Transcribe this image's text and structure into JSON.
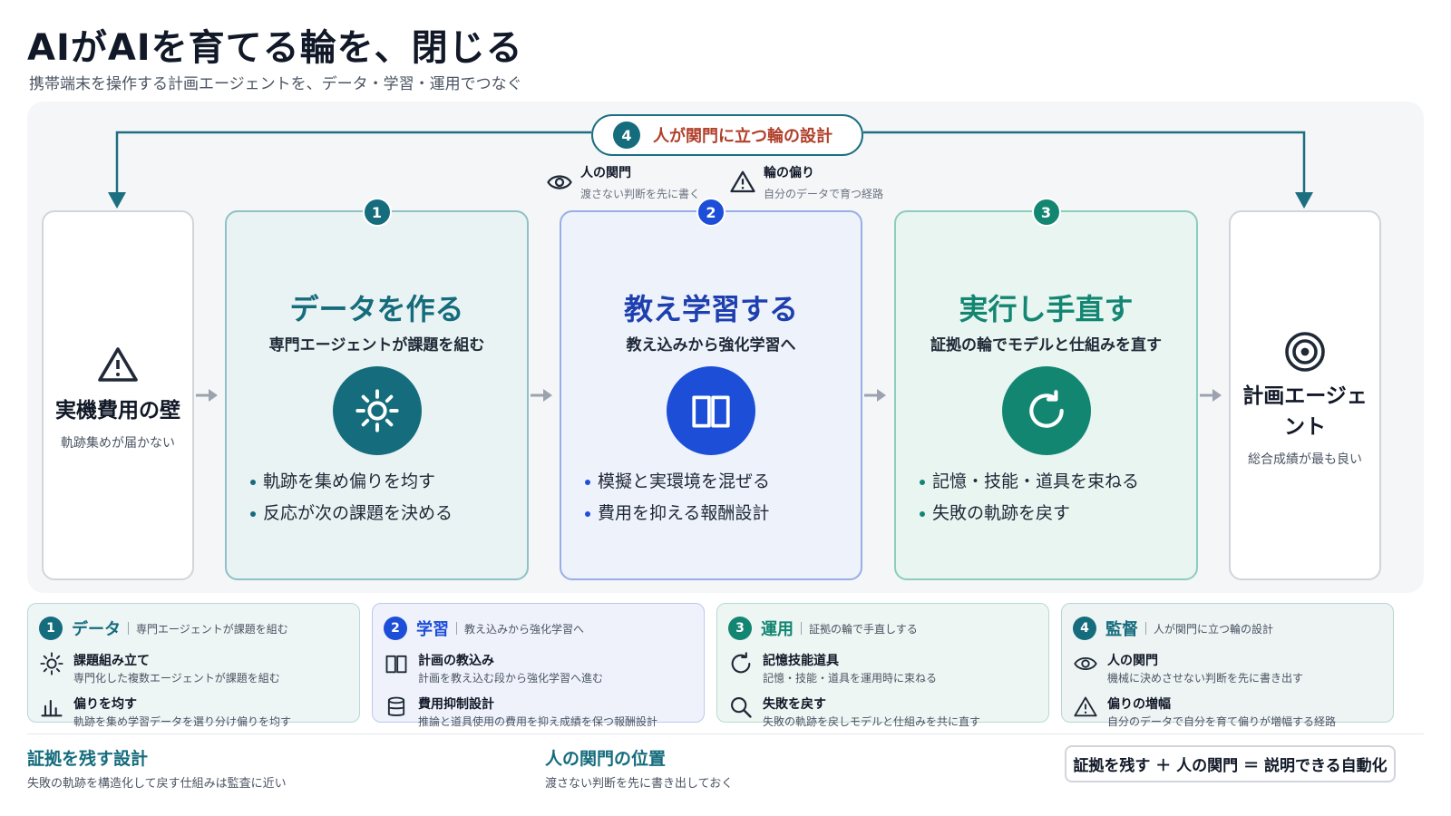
{
  "header": {
    "title": "AIがAIを育てる輪を、閉じる",
    "subtitle": "携帯端末を操作する計画エージェントを、データ・学習・運用でつなぐ"
  },
  "loop": {
    "number": "4",
    "label": "人が関門に立つ輪の設計"
  },
  "notes": [
    {
      "title": "人の関門",
      "desc": "渡さない判断を先に書く",
      "icon": "eye-icon"
    },
    {
      "title": "輪の偏り",
      "desc": "自分のデータで育つ経路",
      "icon": "warning-icon"
    }
  ],
  "start": {
    "title": "実機費用の壁",
    "desc": "軌跡集めが届かない",
    "icon": "warning-icon"
  },
  "stages": [
    {
      "number": "1",
      "title": "データを作る",
      "subtitle": "専門エージェントが課題を組む",
      "icon": "sun-icon",
      "color": "#156c7d",
      "bullets": [
        "軌跡を集め偏りを均す",
        "反応が次の課題を決める"
      ]
    },
    {
      "number": "2",
      "title": "教え学習する",
      "subtitle": "教え込みから強化学習へ",
      "icon": "book-icon",
      "color": "#1d4ed8",
      "bullets": [
        "模擬と実環境を混ぜる",
        "費用を抑える報酬設計"
      ]
    },
    {
      "number": "3",
      "title": "実行し手直す",
      "subtitle": "証拠の輪でモデルと仕組みを直す",
      "icon": "refresh-icon",
      "color": "#138672",
      "bullets": [
        "記憶・技能・道具を束ねる",
        "失敗の軌跡を戻す"
      ]
    }
  ],
  "end": {
    "title_line1": "計画エージェ",
    "title_line2": "ント",
    "desc": "総合成績が最も良い",
    "icon": "target-icon"
  },
  "bottom_cards": [
    {
      "number": "1",
      "name": "データ",
      "desc": "専門エージェントが課題を組む",
      "color": "#156c7d",
      "rows": [
        {
          "icon": "sun-icon",
          "title": "課題組み立て",
          "desc": "専門化した複数エージェントが課題を組む"
        },
        {
          "icon": "bar-chart-icon",
          "title": "偏りを均す",
          "desc": "軌跡を集め学習データを選り分け偏りを均す"
        }
      ]
    },
    {
      "number": "2",
      "name": "学習",
      "desc": "教え込みから強化学習へ",
      "color": "#1d4ed8",
      "rows": [
        {
          "icon": "book-icon",
          "title": "計画の教込み",
          "desc": "計画を教え込む段から強化学習へ進む"
        },
        {
          "icon": "database-icon",
          "title": "費用抑制設計",
          "desc": "推論と道具使用の費用を抑え成績を保つ報酬設計"
        }
      ]
    },
    {
      "number": "3",
      "name": "運用",
      "desc": "証拠の輪で手直しする",
      "color": "#138672",
      "rows": [
        {
          "icon": "refresh-icon",
          "title": "記憶技能道具",
          "desc": "記憶・技能・道具を運用時に束ねる"
        },
        {
          "icon": "search-icon",
          "title": "失敗を戻す",
          "desc": "失敗の軌跡を戻しモデルと仕組みを共に直す"
        }
      ]
    },
    {
      "number": "4",
      "name": "監督",
      "desc": "人が関門に立つ輪の設計",
      "color": "#156c7d",
      "rows": [
        {
          "icon": "eye-icon",
          "title": "人の関門",
          "desc": "機械に決めさせない判断を先に書き出す"
        },
        {
          "icon": "warning-icon",
          "title": "偏りの増幅",
          "desc": "自分のデータで自分を育て偏りが増幅する経路"
        }
      ]
    }
  ],
  "footer": {
    "left_title": "証拠を残す設計",
    "left_desc": "失敗の軌跡を構造化して戻す仕組みは監査に近い",
    "mid_title": "人の関門の位置",
    "mid_desc": "渡さない判断を先に書き出しておく",
    "formula": "証拠を残す ＋ 人の関門 ＝ 説明できる自動化"
  }
}
